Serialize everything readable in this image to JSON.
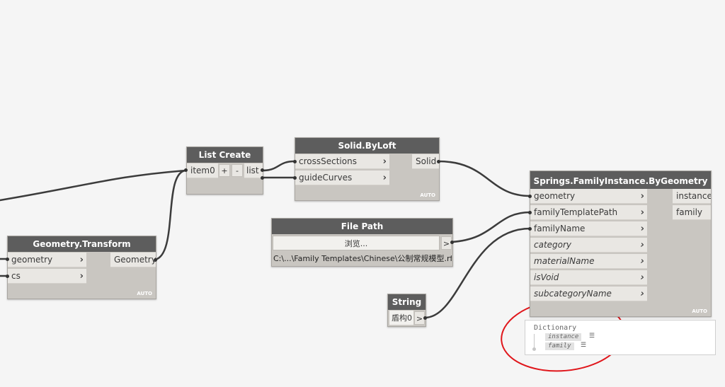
{
  "nodes": {
    "list_create": {
      "title": "List Create",
      "input": "item0",
      "add": "+",
      "remove": "-",
      "output": "list"
    },
    "solid_byloft": {
      "title": "Solid.ByLoft",
      "inputs": [
        "crossSections",
        "guideCurves"
      ],
      "output": "Solid",
      "auto": "AUTO"
    },
    "geometry_transform": {
      "title": "Geometry.Transform",
      "inputs": [
        "geometry",
        "cs"
      ],
      "output": "Geometry",
      "auto": "AUTO"
    },
    "file_path": {
      "title": "File Path",
      "browse": "浏览...",
      "arrow": ">",
      "path": "C:\\...\\Family Templates\\Chinese\\公制常规模型.rft"
    },
    "string": {
      "title": "String",
      "value": "盾构0",
      "arrow": ">"
    },
    "family_instance": {
      "title": "Springs.FamilyInstance.ByGeometry",
      "inputs": [
        "geometry",
        "familyTemplatePath",
        "familyName",
        "category",
        "materialName",
        "isVoid",
        "subcategoryName"
      ],
      "outputs": [
        "instance",
        "family"
      ],
      "auto": "AUTO"
    }
  },
  "preview": {
    "title": "Dictionary",
    "items": [
      "instance",
      "family"
    ]
  },
  "colors": {
    "header": "#5d5d5d",
    "body": "#c9c6c1",
    "port": "#e9e7e3",
    "wire": "#3c3c3c",
    "highlight": "#e0161b",
    "canvas": "#f5f5f5"
  },
  "icons": {
    "chevron": "chevron-right-icon",
    "list": "list-icon"
  }
}
